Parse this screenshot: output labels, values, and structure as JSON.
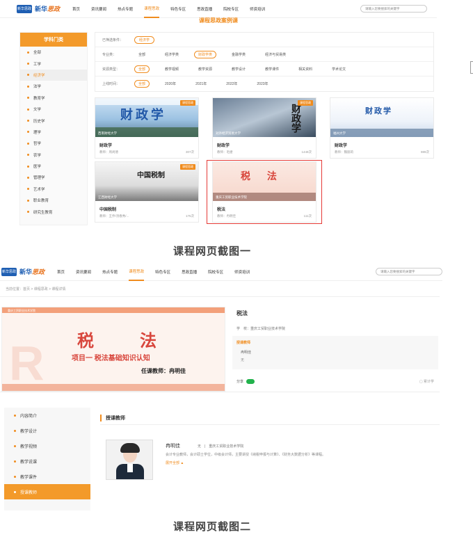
{
  "nav": {
    "logo_mark": "新华思政",
    "logo_text_a": "新华",
    "logo_text_b": "思政",
    "items": [
      "首页",
      "资讯要闻",
      "热点专题",
      "课程思政",
      "特色专区",
      "思政直播",
      "院校专区",
      "师资培训"
    ],
    "search_placeholder": "请输入您要搜索的关键字"
  },
  "shot1": {
    "page_title": "课程思政案例课",
    "sidebar_title": "学科门类",
    "sidebar_items": [
      "全部",
      "工学",
      "经济学",
      "法学",
      "教育学",
      "文学",
      "历史学",
      "理学",
      "哲学",
      "农学",
      "医学",
      "管理学",
      "艺术学",
      "职业教育",
      "研究生教育"
    ],
    "active_sidebar": "经济学",
    "filters": {
      "selected_label": "已筛选条件：",
      "selected_value": "经济学",
      "major_label": "专业类：",
      "majors": [
        "全部",
        "经济学类",
        "财政学类",
        "金融学类",
        "经济与贸易类"
      ],
      "resource_label": "资源类型：",
      "resources": [
        "全部",
        "教学视频",
        "教学资源",
        "教学设计",
        "教学课件",
        "相关资料",
        "学术论文"
      ],
      "time_label": "上线时间：",
      "times": [
        "全部",
        "2020年",
        "2021年",
        "2022年",
        "2023年"
      ]
    },
    "cards": [
      {
        "thumb_title": "财政学",
        "school": "西南财经大学",
        "badge": "课程思政",
        "title": "财政学",
        "meta": "教师：周尚德",
        "count": "307次"
      },
      {
        "thumb_title": "财政学",
        "school": "对外经济贸易大学",
        "badge": "课程思政",
        "title": "财政学",
        "meta": "教师：毛捷",
        "count": "1448次"
      },
      {
        "thumb_title": "财政学",
        "school": "福州大学",
        "badge": "",
        "title": "财政学",
        "meta": "教师：魏丽莉",
        "count": "989次"
      },
      {
        "thumb_title": "中国税制",
        "school": "江西财经大学",
        "badge": "课程思政",
        "title": "中国税制",
        "meta": "教师：王乔/汤春秀/...",
        "count": "175次"
      },
      {
        "thumb_title": "税 法",
        "school": "重庆工贸职业技术学院",
        "badge": "",
        "title": "税法",
        "meta": "教师：冉明佳",
        "count": "111次"
      }
    ]
  },
  "caption1": "课程网页截图一",
  "shot2": {
    "breadcrumb": "当前位置：首页 > 课程思政 > 课程详情",
    "img_title": "税　　法",
    "img_subtitle": "项目一  税法基础知识认知",
    "img_teacher": "任课教师：冉明佳",
    "img_school": "重庆工贸职业技术学院",
    "course_name": "税法",
    "info_line": "学　校：重庆工贸职业技术学院",
    "teacher_head": "授课教师",
    "teacher_name": "冉明佳",
    "teacher_unit": "无",
    "share_label": "分享",
    "stat": "累计学",
    "sidebar": [
      "内容简介",
      "教学设计",
      "教学视频",
      "教学说课",
      "教学课件",
      "授课教师"
    ],
    "active_sidebar": "授课教师",
    "section_title": "授课教师",
    "t_name": "冉明佳",
    "t_unit": "无　|　重庆工贸职业技术学院",
    "t_desc": "会计专业教师，会计硕士学位，中级会计师，主要讲授《纳税申报与计算》、《财务大数据分析》等课程。",
    "t_more": "展开全部"
  },
  "caption2": "课程网页截图二",
  "colors": {
    "accent": "#f08c1e",
    "brand": "#1f5fb3",
    "highlight": "#e53935"
  }
}
